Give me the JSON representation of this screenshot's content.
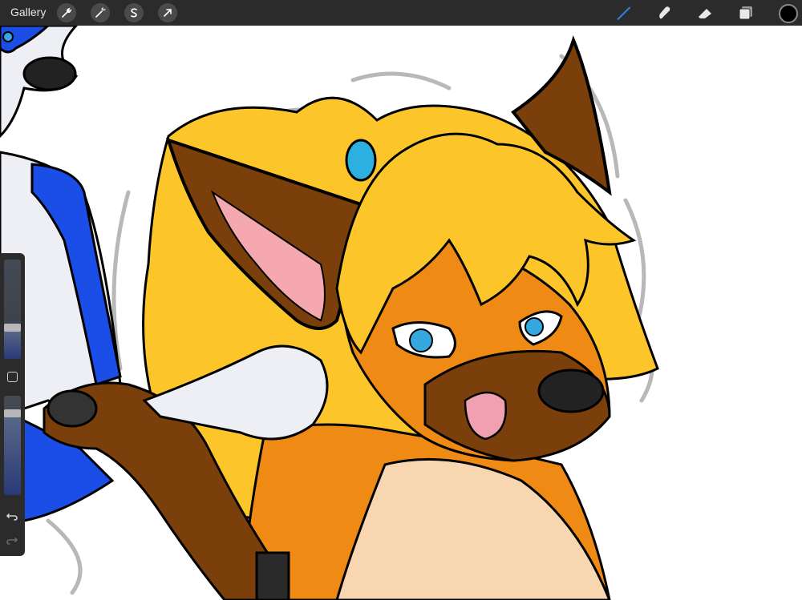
{
  "app": {
    "gallery_label": "Gallery"
  },
  "toolbar_left": [
    {
      "name": "actions-wrench-icon"
    },
    {
      "name": "adjustments-wand-icon"
    },
    {
      "name": "selection-s-icon"
    },
    {
      "name": "transform-arrow-icon"
    }
  ],
  "toolbar_right": [
    {
      "name": "brush-icon",
      "active": true
    },
    {
      "name": "smudge-icon",
      "active": false
    },
    {
      "name": "eraser-icon",
      "active": false
    },
    {
      "name": "layers-icon",
      "active": false
    }
  ],
  "colors": {
    "toolbar_bg": "#2b2b2b",
    "active_tool": "#2f7de1",
    "current_color": "#000000",
    "blue_fur": "#1a4ee6",
    "yellow_hair": "#fcc62b",
    "brown_fur": "#7a3f0a",
    "orange_fur": "#ef8a14",
    "cream": "#f7d6b0",
    "eye_blue": "#35a8e0"
  },
  "sidebar": {
    "brush_size_level": 0.3,
    "opacity_level": 0.85,
    "controls": [
      "brush-size-slider",
      "modify-button",
      "opacity-slider",
      "undo-icon",
      "redo-icon"
    ]
  }
}
